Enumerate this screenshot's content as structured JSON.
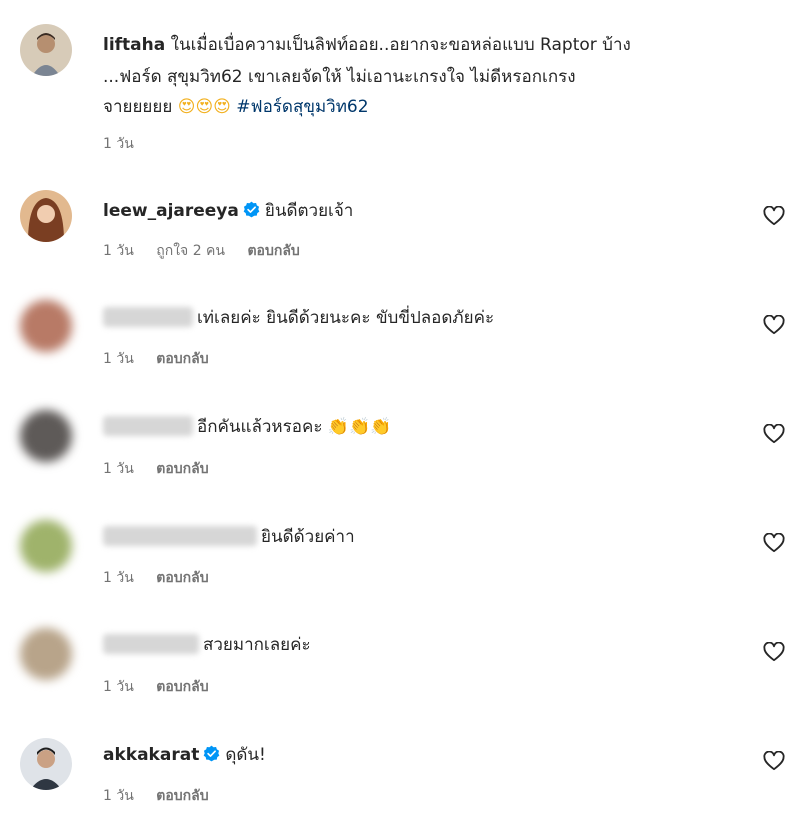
{
  "comments": [
    {
      "username": "liftaha",
      "lines": [
        "ในเมื่อเบื่อความเป็นลิฟท์ออย..อยากจะขอหล่อแบบ Raptor บ้าง",
        "...ฟอร์ด สุขุมวิท62 เขาเลยจัดให้ ไม่เอานะเกรงใจ ไม่ดีหรอกเกรง",
        "จายยยยย"
      ],
      "emoji": "😍😍😍",
      "hashtag": "#ฟอร์ดสุขุมวิท62",
      "time": "1 วัน",
      "avatar_color": "#c9b59a"
    },
    {
      "username": "leew_ajareeya",
      "verified": true,
      "text": "ยินดีตวยเจ้า",
      "time": "1 วัน",
      "likes": "ถูกใจ 2 คน",
      "reply": "ตอบกลับ",
      "avatar_color": "#c97c5d"
    },
    {
      "text": "เท่เลยค่ะ ยินดีด้วยนะคะ ขับขี่ปลอดภัยค่ะ",
      "time": "1 วัน",
      "reply": "ตอบกลับ",
      "avatar_color": "#b87a66"
    },
    {
      "text": "อีกคันแล้วหรอคะ",
      "emoji": "👏👏👏",
      "time": "1 วัน",
      "reply": "ตอบกลับ",
      "avatar_color": "#5e5a58"
    },
    {
      "text": "ยินดีด้วยค่าา",
      "time": "1 วัน",
      "reply": "ตอบกลับ",
      "avatar_color": "#9fb36b"
    },
    {
      "text": "สวยมากเลยค่ะ",
      "time": "1 วัน",
      "reply": "ตอบกลับ",
      "avatar_color": "#b8a48a"
    },
    {
      "username": "akkakarat",
      "verified": true,
      "text": "ดุดัน!",
      "time": "1 วัน",
      "reply": "ตอบกลับ",
      "avatar_color": "#4a5561"
    }
  ],
  "colors": {
    "verified": "#0095f6",
    "hashtag": "#00376b",
    "meta": "#737373"
  }
}
